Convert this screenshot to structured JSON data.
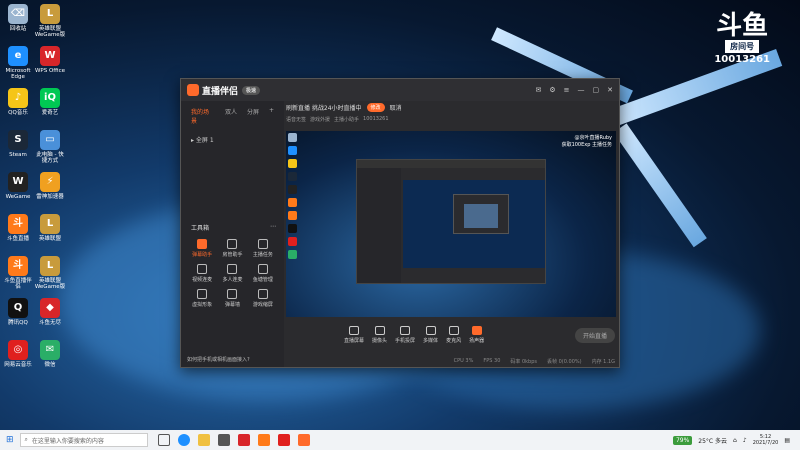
{
  "desktop": {
    "icons": [
      {
        "label": "回收站",
        "color": "#9bb5d0",
        "glyph": "⌫"
      },
      {
        "label": "英雄联盟WeGame版",
        "color": "#c89b3c",
        "glyph": "L"
      },
      {
        "label": "Microsoft Edge",
        "color": "#1e90ff",
        "glyph": "e"
      },
      {
        "label": "WPS Office",
        "color": "#d8262a",
        "glyph": "W"
      },
      {
        "label": "QQ音乐",
        "color": "#f5c518",
        "glyph": "♪"
      },
      {
        "label": "爱奇艺",
        "color": "#00c853",
        "glyph": "iQ"
      },
      {
        "label": "Steam",
        "color": "#1b2838",
        "glyph": "S"
      },
      {
        "label": "此电脑 - 快捷方式",
        "color": "#4a90d9",
        "glyph": "▭"
      },
      {
        "label": "WeGame",
        "color": "#222",
        "glyph": "W"
      },
      {
        "label": "雷神加速器",
        "color": "#f0a020",
        "glyph": "⚡"
      },
      {
        "label": "斗鱼直播",
        "color": "#ff7a1a",
        "glyph": "斗"
      },
      {
        "label": "英雄联盟",
        "color": "#c89b3c",
        "glyph": "L"
      },
      {
        "label": "斗鱼直播伴侣",
        "color": "#ff7a1a",
        "glyph": "斗"
      },
      {
        "label": "英雄联盟WeGame版",
        "color": "#c89b3c",
        "glyph": "L"
      },
      {
        "label": "腾讯QQ",
        "color": "#111",
        "glyph": "Q"
      },
      {
        "label": "斗鱼无尽",
        "color": "#d8262a",
        "glyph": "◆"
      },
      {
        "label": "网易云音乐",
        "color": "#e0201e",
        "glyph": "◎"
      },
      {
        "label": "微信",
        "color": "#2aae67",
        "glyph": "✉"
      }
    ]
  },
  "badge": {
    "logo": "斗鱼",
    "room_label": "房间号",
    "room_number": "10013261"
  },
  "app": {
    "title": "直播伴侣",
    "version_pill": "极速",
    "left_tabs": [
      "我的场景",
      "双人",
      "分屏"
    ],
    "scene_label": "全屏 1",
    "tools_title": "工具箱",
    "tools": [
      {
        "label": "弹幕助手",
        "hot": true
      },
      {
        "label": "房管助手",
        "hot": false
      },
      {
        "label": "主播任务",
        "hot": false
      },
      {
        "label": "视频连麦",
        "hot": false
      },
      {
        "label": "多人连麦",
        "hot": false
      },
      {
        "label": "鱼塘管理",
        "hot": false
      },
      {
        "label": "虚拟形象",
        "hot": false
      },
      {
        "label": "弹幕墙",
        "hot": false
      },
      {
        "label": "游戏缩屏",
        "hot": false
      }
    ],
    "tip": "如何把手机或相机画面接入?",
    "room_title": "刷新直播 挑战24小时直播中",
    "room_btn1": "修改",
    "room_btn2": "取消",
    "room_meta": [
      "语音无签",
      "游戏外援",
      "主播小助手",
      "10013261"
    ],
    "overlay_lines": [
      "@京叶直播Ruby",
      "获取100Exp 主播任务"
    ],
    "bottom_buttons": [
      {
        "label": "直播屏幕",
        "hot": false
      },
      {
        "label": "摄像头",
        "hot": false
      },
      {
        "label": "手机投屏",
        "hot": false
      },
      {
        "label": "多媒体",
        "hot": false
      },
      {
        "label": "麦克风",
        "hot": false
      },
      {
        "label": "扬声器",
        "hot": true
      }
    ],
    "start_live": "开始直播",
    "status": [
      "CPU 3%",
      "FPS 30",
      "码率 0kbps",
      "丢帧 0(0.00%)",
      "内存 1.1G"
    ]
  },
  "taskbar": {
    "search_placeholder": "在这里输入你要搜索的内容",
    "battery": "79%",
    "temperature": "25°C 多云",
    "time": "5:12",
    "date": "2021/7/20"
  }
}
